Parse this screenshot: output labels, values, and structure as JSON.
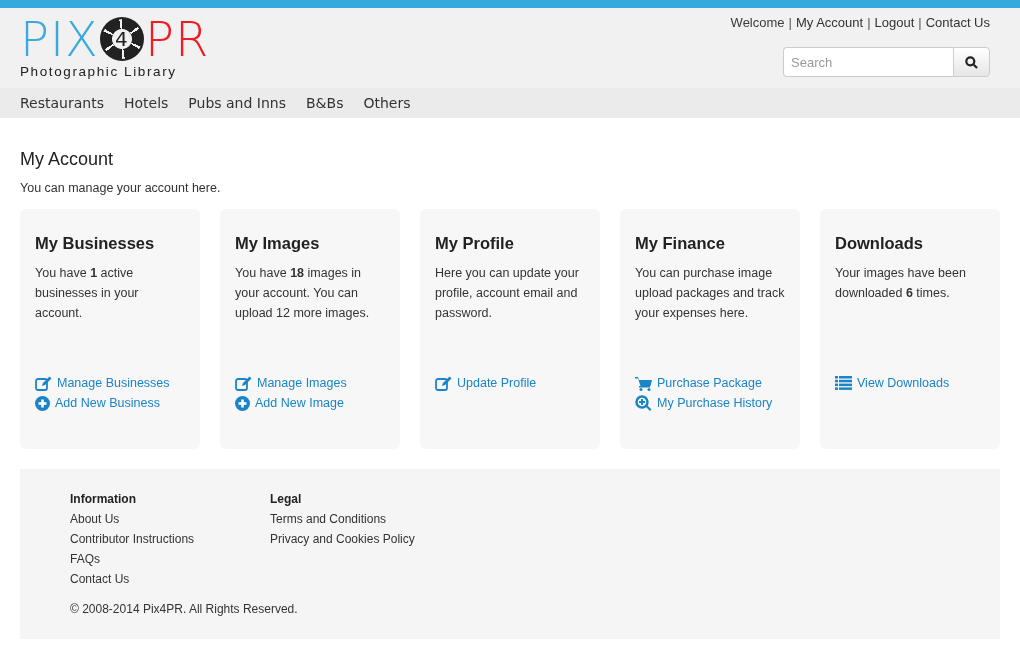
{
  "logo": {
    "left": "PIX",
    "middle": "4",
    "right": "PR",
    "tagline": "Photographic Library"
  },
  "top_links": [
    {
      "kind": "text",
      "label": "Welcome"
    },
    {
      "kind": "separator",
      "label": "|"
    },
    {
      "kind": "link",
      "label": "My Account"
    },
    {
      "kind": "separator",
      "label": "|"
    },
    {
      "kind": "link",
      "label": "Logout"
    },
    {
      "kind": "separator",
      "label": "|"
    },
    {
      "kind": "link",
      "label": "Contact Us"
    }
  ],
  "search": {
    "placeholder": "Search"
  },
  "nav": [
    "Restaurants",
    "Hotels",
    "Pubs and Inns",
    "B&Bs",
    "Others"
  ],
  "page": {
    "title": "My Account",
    "intro": "You can manage your account here."
  },
  "cards": [
    {
      "title": "My Businesses",
      "text": "You have **1** active businesses in your account.",
      "links": [
        {
          "kind": "edit",
          "label": "Manage Businesses"
        },
        {
          "kind": "add",
          "label": "Add New Business"
        }
      ]
    },
    {
      "title": "My Images",
      "text": "You have **18** images in your account. You can upload 12 more images.",
      "links": [
        {
          "kind": "edit",
          "label": "Manage Images"
        },
        {
          "kind": "add",
          "label": "Add New Image"
        }
      ]
    },
    {
      "title": "My Profile",
      "text": "Here you can update your profile, account email and password.",
      "links": [
        {
          "kind": "edit",
          "label": "Update Profile"
        }
      ]
    },
    {
      "title": "My Finance",
      "text": "You can purchase image upload packages and track your expenses here.",
      "links": [
        {
          "kind": "purchase",
          "label": "Purchase Package"
        },
        {
          "kind": "history",
          "label": "My Purchase History"
        }
      ]
    },
    {
      "title": "Downloads",
      "text": "Your images have been downloaded **6** times.",
      "links": [
        {
          "kind": "view",
          "label": "View Downloads"
        }
      ]
    }
  ],
  "footer": {
    "columns": [
      {
        "heading": "Information",
        "links": [
          "About Us",
          "Contributor Instructions",
          "FAQs",
          "Contact Us"
        ]
      },
      {
        "heading": "Legal",
        "links": [
          "Terms and Conditions",
          "Privacy and Cookies Policy"
        ]
      }
    ],
    "copyright": "© 2008-2014 Pix4PR. All Rights Reserved."
  }
}
